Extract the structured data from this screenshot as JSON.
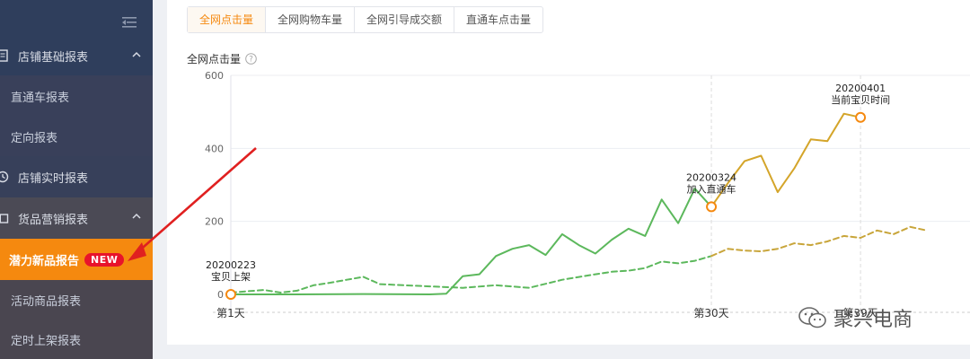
{
  "sidebar": {
    "items": [
      {
        "label": "店铺基础报表",
        "kind": "group",
        "icon": "report-icon"
      },
      {
        "label": "直通车报表",
        "kind": "sub"
      },
      {
        "label": "定向报表",
        "kind": "sub"
      },
      {
        "label": "店铺实时报表",
        "kind": "group",
        "icon": "realtime-icon"
      },
      {
        "label": "货品营销报表",
        "kind": "group",
        "icon": "goods-icon"
      },
      {
        "label": "潜力新品报告",
        "kind": "active",
        "badge": "NEW"
      },
      {
        "label": "活动商品报表",
        "kind": "sub"
      },
      {
        "label": "定时上架报表",
        "kind": "sub"
      }
    ]
  },
  "tabs": [
    {
      "label": "全网点击量",
      "active": true
    },
    {
      "label": "全网购物车量",
      "active": false
    },
    {
      "label": "全网引导成交额",
      "active": false
    },
    {
      "label": "直通车点击量",
      "active": false
    }
  ],
  "chart": {
    "title": "全网点击量"
  },
  "chart_data": {
    "type": "line",
    "title": "全网点击量",
    "ylim": [
      0,
      600
    ],
    "yticks": [
      0,
      200,
      400,
      600
    ],
    "xlim": [
      1,
      43
    ],
    "xtick_labels": [
      {
        "day": 1,
        "label": "第1天"
      },
      {
        "day": 30,
        "label": "第30天"
      },
      {
        "day": 39,
        "label": "第39天"
      }
    ],
    "grid": true,
    "series": [
      {
        "style": "solid",
        "color_segments": [
          "#5cb85c",
          "#d4a52a"
        ],
        "points": [
          [
            1,
            0
          ],
          [
            5,
            0
          ],
          [
            9,
            1
          ],
          [
            13,
            0
          ],
          [
            14,
            2
          ],
          [
            15,
            50
          ],
          [
            16,
            55
          ],
          [
            17,
            105
          ],
          [
            18,
            125
          ],
          [
            19,
            135
          ],
          [
            20,
            108
          ],
          [
            21,
            165
          ],
          [
            22,
            135
          ],
          [
            23,
            112
          ],
          [
            24,
            150
          ],
          [
            25,
            180
          ],
          [
            26,
            160
          ],
          [
            27,
            260
          ],
          [
            28,
            195
          ],
          [
            29,
            290
          ],
          [
            30,
            240
          ],
          [
            31,
            305
          ],
          [
            32,
            365
          ],
          [
            33,
            380
          ],
          [
            34,
            280
          ],
          [
            35,
            345
          ],
          [
            36,
            425
          ],
          [
            37,
            420
          ],
          [
            38,
            495
          ],
          [
            39,
            485
          ]
        ]
      },
      {
        "style": "dashed",
        "color_segments": [
          "#5cb85c",
          "#c8a53a"
        ],
        "points": [
          [
            1,
            5
          ],
          [
            3,
            12
          ],
          [
            4,
            5
          ],
          [
            5,
            10
          ],
          [
            6,
            25
          ],
          [
            7,
            32
          ],
          [
            8,
            40
          ],
          [
            9,
            48
          ],
          [
            10,
            28
          ],
          [
            13,
            22
          ],
          [
            15,
            18
          ],
          [
            17,
            25
          ],
          [
            19,
            18
          ],
          [
            21,
            40
          ],
          [
            23,
            55
          ],
          [
            24,
            62
          ],
          [
            25,
            65
          ],
          [
            26,
            72
          ],
          [
            27,
            90
          ],
          [
            28,
            85
          ],
          [
            29,
            92
          ],
          [
            30,
            105
          ],
          [
            31,
            125
          ],
          [
            32,
            120
          ],
          [
            33,
            118
          ],
          [
            34,
            125
          ],
          [
            35,
            140
          ],
          [
            36,
            135
          ],
          [
            37,
            145
          ],
          [
            38,
            160
          ],
          [
            39,
            155
          ],
          [
            40,
            175
          ],
          [
            41,
            165
          ],
          [
            42,
            185
          ],
          [
            43,
            175
          ]
        ]
      }
    ],
    "annotations": [
      {
        "day": 1,
        "value": 0,
        "lines": [
          "20200223",
          "宝贝上架"
        ]
      },
      {
        "day": 30,
        "value": 240,
        "lines": [
          "20200324",
          "加入直通车"
        ]
      },
      {
        "day": 39,
        "value": 485,
        "lines": [
          "20200401",
          "当前宝贝时间"
        ]
      }
    ]
  },
  "watermark": {
    "text": "聚兴电商"
  }
}
